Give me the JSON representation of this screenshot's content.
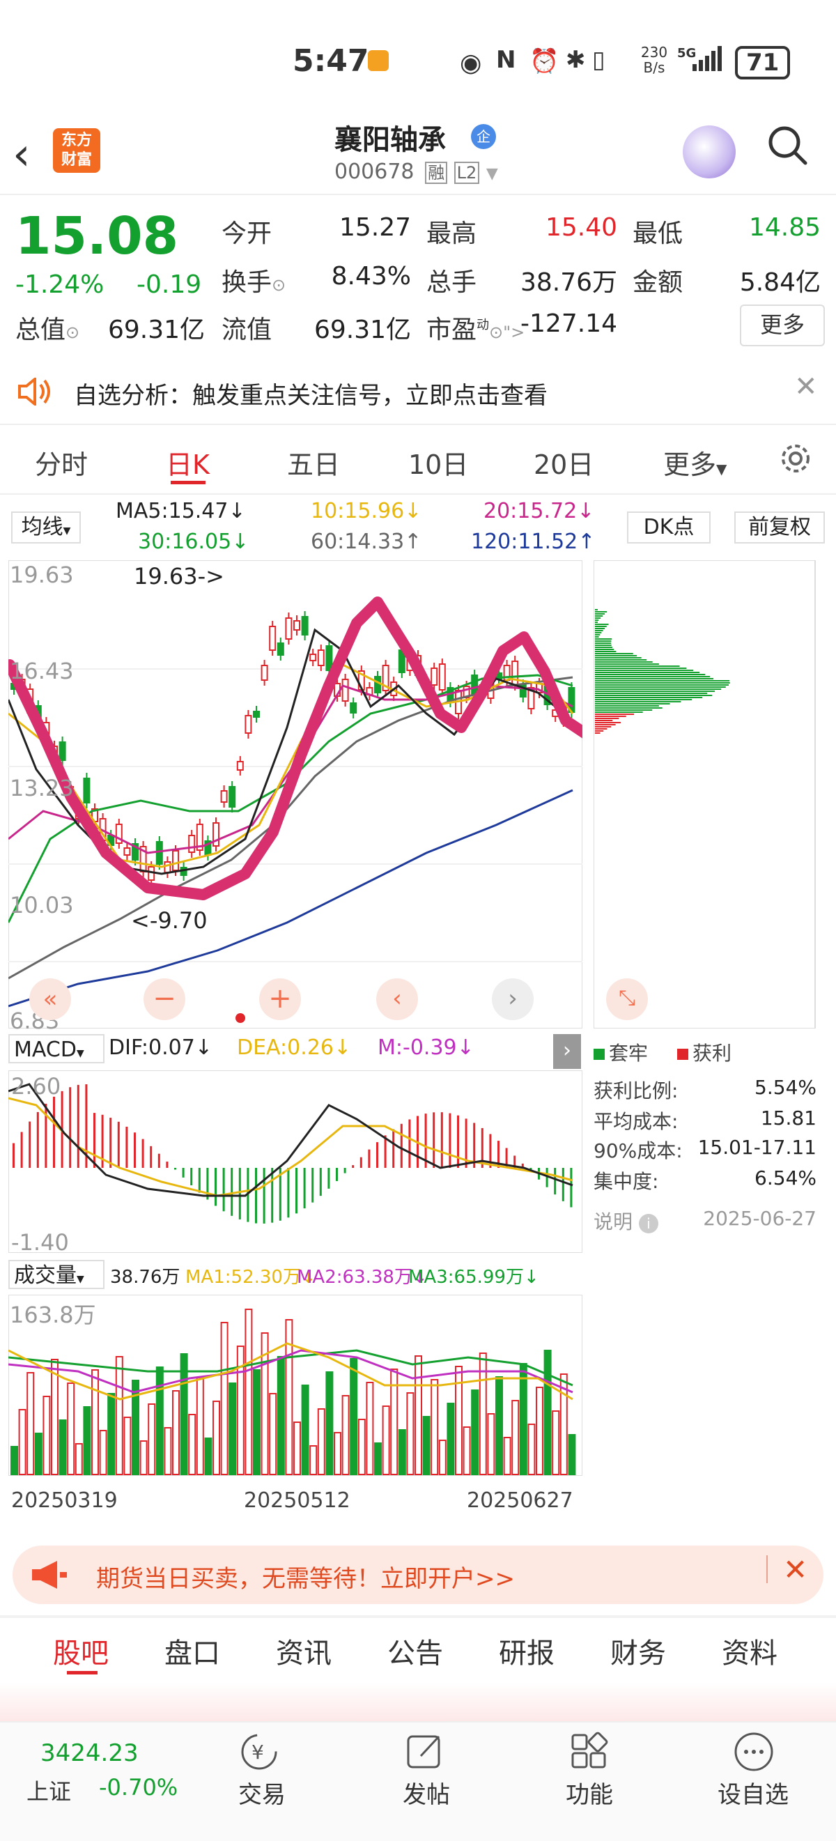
{
  "status_bar": {
    "time": "5:47",
    "speed": "230\nB/s",
    "network": "5G",
    "battery": "71"
  },
  "header": {
    "logo_text": "东方\n财富",
    "stock_name": "襄阳轴承",
    "badge": "企",
    "code": "000678",
    "tag_rong": "融",
    "tag_l2": "L2"
  },
  "quote": {
    "price": "15.08",
    "change_pct": "-1.24%",
    "change_val": "-0.19",
    "rows": [
      [
        {
          "label": "今开",
          "value": "15.27",
          "color": "#222"
        },
        {
          "label": "最高",
          "value": "15.40",
          "color": "#e0262b"
        },
        {
          "label": "最低",
          "value": "14.85",
          "color": "#13a02f"
        }
      ],
      [
        {
          "label": "换手",
          "value": "8.43%",
          "color": "#222"
        },
        {
          "label": "总手",
          "value": "38.76万",
          "color": "#222"
        },
        {
          "label": "金额",
          "value": "5.84亿",
          "color": "#222"
        }
      ]
    ],
    "total_cap_label": "总值",
    "total_cap": "69.31亿",
    "float_cap_label": "流值",
    "float_cap": "69.31亿",
    "pe_label": "市盈",
    "pe_sup": "动",
    "pe": "-127.14",
    "more": "更多"
  },
  "notice": {
    "text": "自选分析：触发重点关注信号，立即点击查看"
  },
  "chart_tabs": [
    "分时",
    "日K",
    "五日",
    "10日",
    "20日",
    "更多"
  ],
  "ma_legend": {
    "selector": "均线",
    "ma5": "MA5:15.47↓",
    "ma10": "10:15.96↓",
    "ma20": "20:15.72↓",
    "ma30": "30:16.05↓",
    "ma60": "60:14.33↑",
    "ma120": "120:11.52↑",
    "dk": "DK点",
    "fq": "前复权"
  },
  "kline_axis": {
    "high": "19.63",
    "y2": "16.43",
    "y3": "13.23",
    "y4": "10.03",
    "low": "6.83",
    "max_marker": "19.63->",
    "min_marker": "<-9.70"
  },
  "colors": {
    "up": "#e0262b",
    "down": "#13a02f",
    "ma5": "#222222",
    "ma10": "#e8b70f",
    "ma20": "#c8268a",
    "ma30": "#13a02f",
    "ma60": "#666666",
    "ma120": "#1e3a9a",
    "drawing": "#d8306e"
  },
  "macd": {
    "selector": "MACD",
    "dif": "DIF:0.07↓",
    "dea": "DEA:0.26↓",
    "m": "M:-0.39↓",
    "top": "2.60",
    "bottom": "-1.40"
  },
  "chip": {
    "legend_trapped": "套牢",
    "legend_profit": "获利",
    "rows": [
      {
        "label": "获利比例:",
        "value": "5.54%"
      },
      {
        "label": "平均成本:",
        "value": "15.81"
      },
      {
        "label": "90%成本:",
        "value": "15.01-17.11"
      },
      {
        "label": "集中度:",
        "value": "6.54%"
      }
    ],
    "note": "说明",
    "date": "2025-06-27"
  },
  "volume": {
    "selector": "成交量",
    "vol": "38.76万",
    "ma1": "MA1:52.30万↓",
    "ma2": "MA2:63.38万↓",
    "ma3": "MA3:65.99万↓",
    "top": "163.8万",
    "dates": [
      "20250319",
      "20250512",
      "20250627"
    ]
  },
  "ad": {
    "text": "期货当日买卖，无需等待！立即开户>>"
  },
  "bottom_tabs": [
    "股吧",
    "盘口",
    "资讯",
    "公告",
    "研报",
    "财务",
    "资料"
  ],
  "bottom_nav": {
    "index_value": "3424.23",
    "index_name": "上证",
    "index_change": "-0.70%",
    "items": [
      "交易",
      "发帖",
      "功能",
      "设自选"
    ]
  }
}
